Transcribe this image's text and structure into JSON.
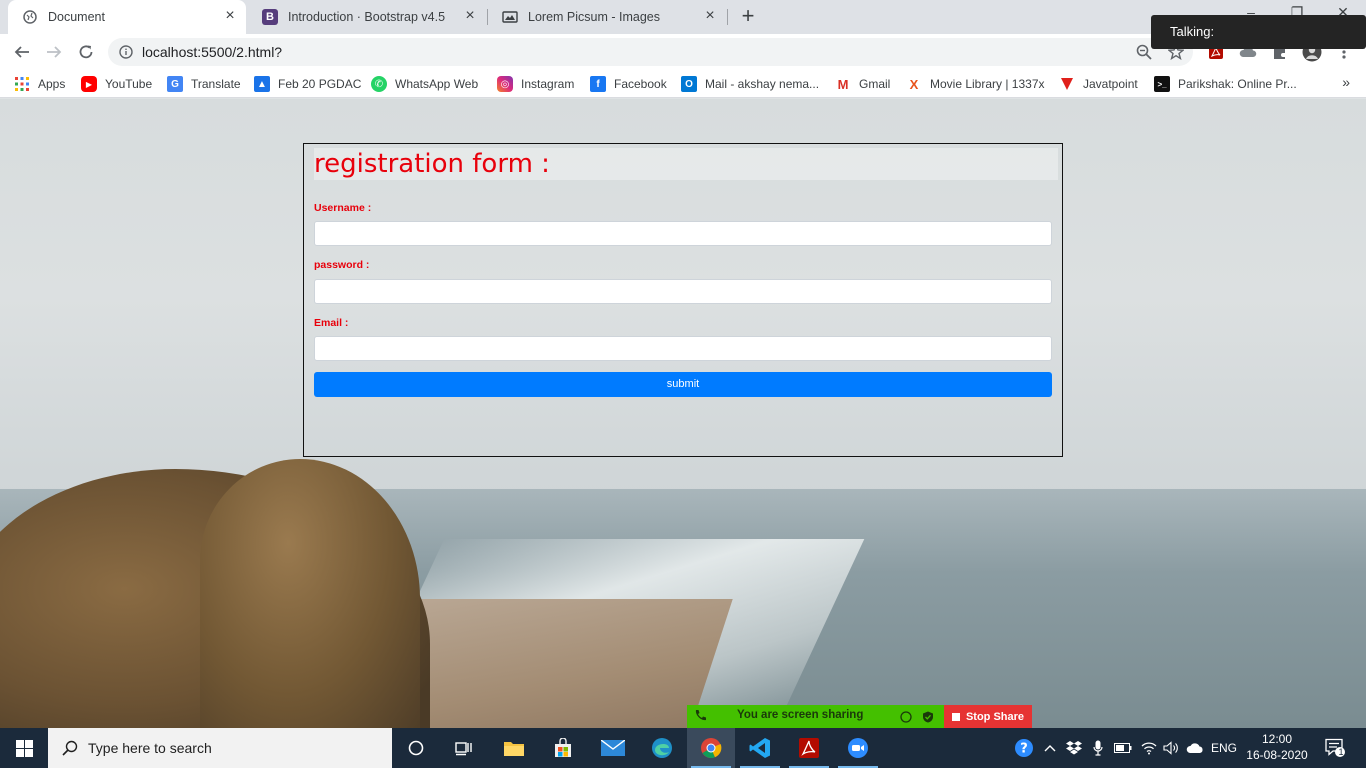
{
  "browser": {
    "tabs": [
      {
        "title": "Document",
        "active": true
      },
      {
        "title": "Introduction · Bootstrap v4.5",
        "active": false
      },
      {
        "title": "Lorem Picsum - Images",
        "active": false
      }
    ],
    "url": "localhost:5500/2.html?",
    "bookmarks": [
      {
        "label": "Apps",
        "icon": "apps-grid-icon"
      },
      {
        "label": "YouTube",
        "icon": "youtube-icon",
        "color": "#ff0000"
      },
      {
        "label": "Translate",
        "icon": "translate-icon",
        "color": "#4285f4"
      },
      {
        "label": "Feb 20 PGDAC",
        "icon": "classroom-icon",
        "color": "#1a73e8"
      },
      {
        "label": "WhatsApp Web",
        "icon": "whatsapp-icon",
        "color": "#25d366"
      },
      {
        "label": "Instagram",
        "icon": "instagram-icon",
        "color": "#c13584"
      },
      {
        "label": "Facebook",
        "icon": "facebook-icon",
        "color": "#1877f2"
      },
      {
        "label": "Mail - akshay nema...",
        "icon": "outlook-icon",
        "color": "#0078d4"
      },
      {
        "label": "Gmail",
        "icon": "gmail-icon",
        "color": "#d93025"
      },
      {
        "label": "Movie Library | 1337x",
        "icon": "1337x-icon",
        "color": "#e8531c"
      },
      {
        "label": "Javatpoint",
        "icon": "javatpoint-icon",
        "color": "#e0201b"
      },
      {
        "label": "Parikshak: Online Pr...",
        "icon": "terminal-icon",
        "color": "#111111"
      }
    ],
    "bookmarks_overflow": "»"
  },
  "zoom": {
    "talking_label": "Talking:",
    "sharing_text": "You are screen sharing",
    "stop_share_label": "Stop Share"
  },
  "form": {
    "heading": "registration form :",
    "username_label": "Username :",
    "username_value": "",
    "password_label": "password :",
    "password_value": "",
    "email_label": "Email :",
    "email_value": "",
    "submit_label": "submit"
  },
  "taskbar": {
    "search_placeholder": "Type here to search",
    "language": "ENG",
    "time": "12:00",
    "date": "16-08-2020",
    "notification_count": "1"
  },
  "colors": {
    "heading_red": "#e8000b",
    "submit_blue": "#007bff",
    "share_green": "#44c000",
    "stop_red": "#e63333"
  }
}
